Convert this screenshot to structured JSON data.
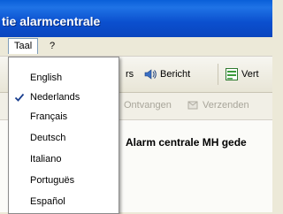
{
  "window": {
    "title": "tie  alarmcentrale"
  },
  "menubar": {
    "items": [
      {
        "label": "Taal"
      },
      {
        "label": "?"
      }
    ]
  },
  "toolbar": {
    "partial_button_label": "rs",
    "report_label": "Bericht",
    "partial_label": "Vert"
  },
  "toolbar2": {
    "received_label": "Ontvangen",
    "sent_label": "Verzenden"
  },
  "content": {
    "heading": "Alarm centrale MH gede"
  },
  "language_menu": {
    "items": [
      {
        "label": "English",
        "checked": false
      },
      {
        "label": "Nederlands",
        "checked": true
      },
      {
        "label": "Français",
        "checked": false
      },
      {
        "label": "Deutsch",
        "checked": false
      },
      {
        "label": "Italiano",
        "checked": false
      },
      {
        "label": "Portuguës",
        "checked": false
      },
      {
        "label": "Español",
        "checked": false
      }
    ]
  }
}
